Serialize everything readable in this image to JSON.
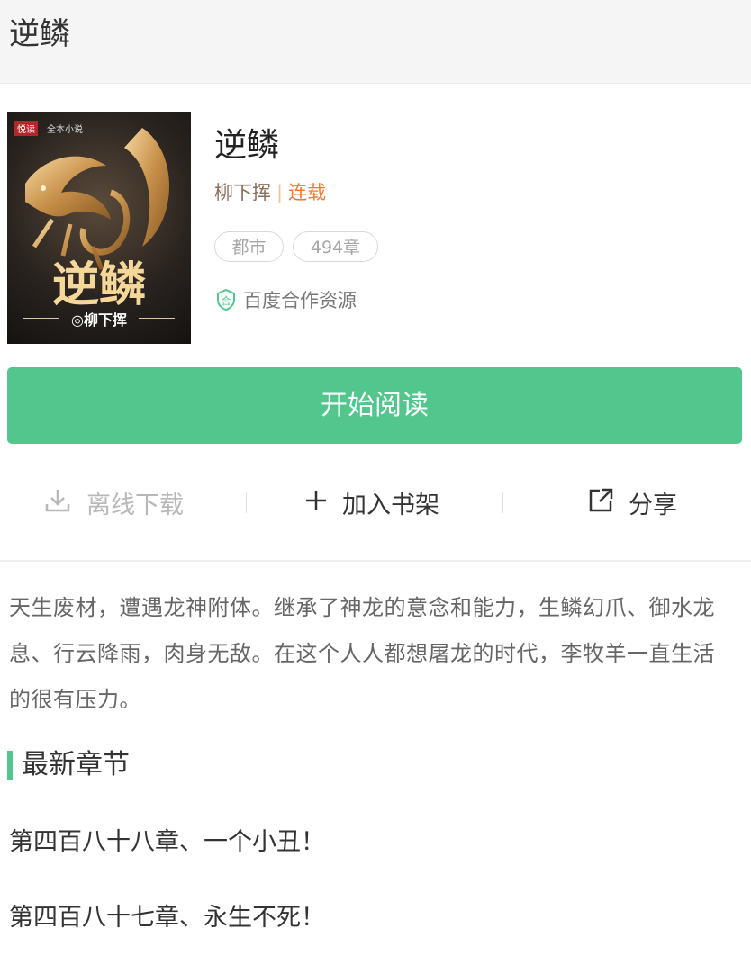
{
  "header": {
    "title": "逆鳞"
  },
  "book": {
    "cover": {
      "publisher": "悦读",
      "publisher_sub": "全本小说",
      "title": "逆鳞",
      "author": "◎柳下挥"
    },
    "title": "逆鳞",
    "author": "柳下挥",
    "separator": "|",
    "status": "连载",
    "tags": [
      "都市",
      "494章"
    ],
    "partner_label": "百度合作资源"
  },
  "read_button": {
    "label": "开始阅读"
  },
  "actions": {
    "download_label": "离线下载",
    "shelf_label": "加入书架",
    "share_label": "分享"
  },
  "description": "天生废材，遭遇龙神附体。继承了神龙的意念和能力，生鳞幻爪、御水龙息、行云降雨，肉身无敌。在这个人人都想屠龙的时代，李牧羊一直生活的很有压力。",
  "latest": {
    "title": "最新章节",
    "chapters": [
      "第四百八十八章、一个小丑！",
      "第四百八十七章、永生不死！"
    ]
  },
  "colors": {
    "accent_green": "#52c68d",
    "status_orange": "#ef7a32",
    "author_brown": "#8a6d5a"
  }
}
